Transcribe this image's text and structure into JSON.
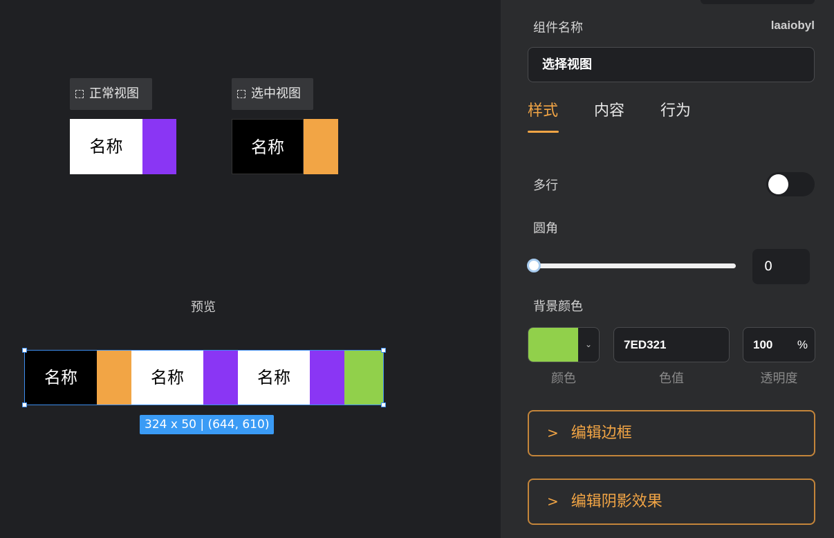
{
  "canvas": {
    "normal_view": {
      "label": "正常视图",
      "cell_text": "名称",
      "accent_color": "#8a36f4"
    },
    "selected_view": {
      "label": "选中视图",
      "cell_text": "名称",
      "accent_color": "#f2a545"
    },
    "preview_label": "预览",
    "preview_cells": [
      "名称",
      "名称",
      "名称"
    ],
    "size_badge": "324 x 50 | (644, 610)"
  },
  "panel": {
    "component_name_label": "组件名称",
    "component_id": "laaiobyl",
    "component_name_value": "选择视图",
    "tabs": [
      {
        "label": "样式",
        "active": true
      },
      {
        "label": "内容",
        "active": false
      },
      {
        "label": "行为",
        "active": false
      }
    ],
    "multiline_label": "多行",
    "multiline_on": false,
    "radius_label": "圆角",
    "radius_value": "0",
    "bg_color_label": "背景颜色",
    "bg_color": "#91d04b",
    "color_hex": "7ED321",
    "opacity_value": "100",
    "opacity_unit": "%",
    "sub_labels": {
      "color": "颜色",
      "value": "色值",
      "opacity": "透明度"
    },
    "edit_border_label": "编辑边框",
    "edit_shadow_label": "编辑阴影效果"
  }
}
